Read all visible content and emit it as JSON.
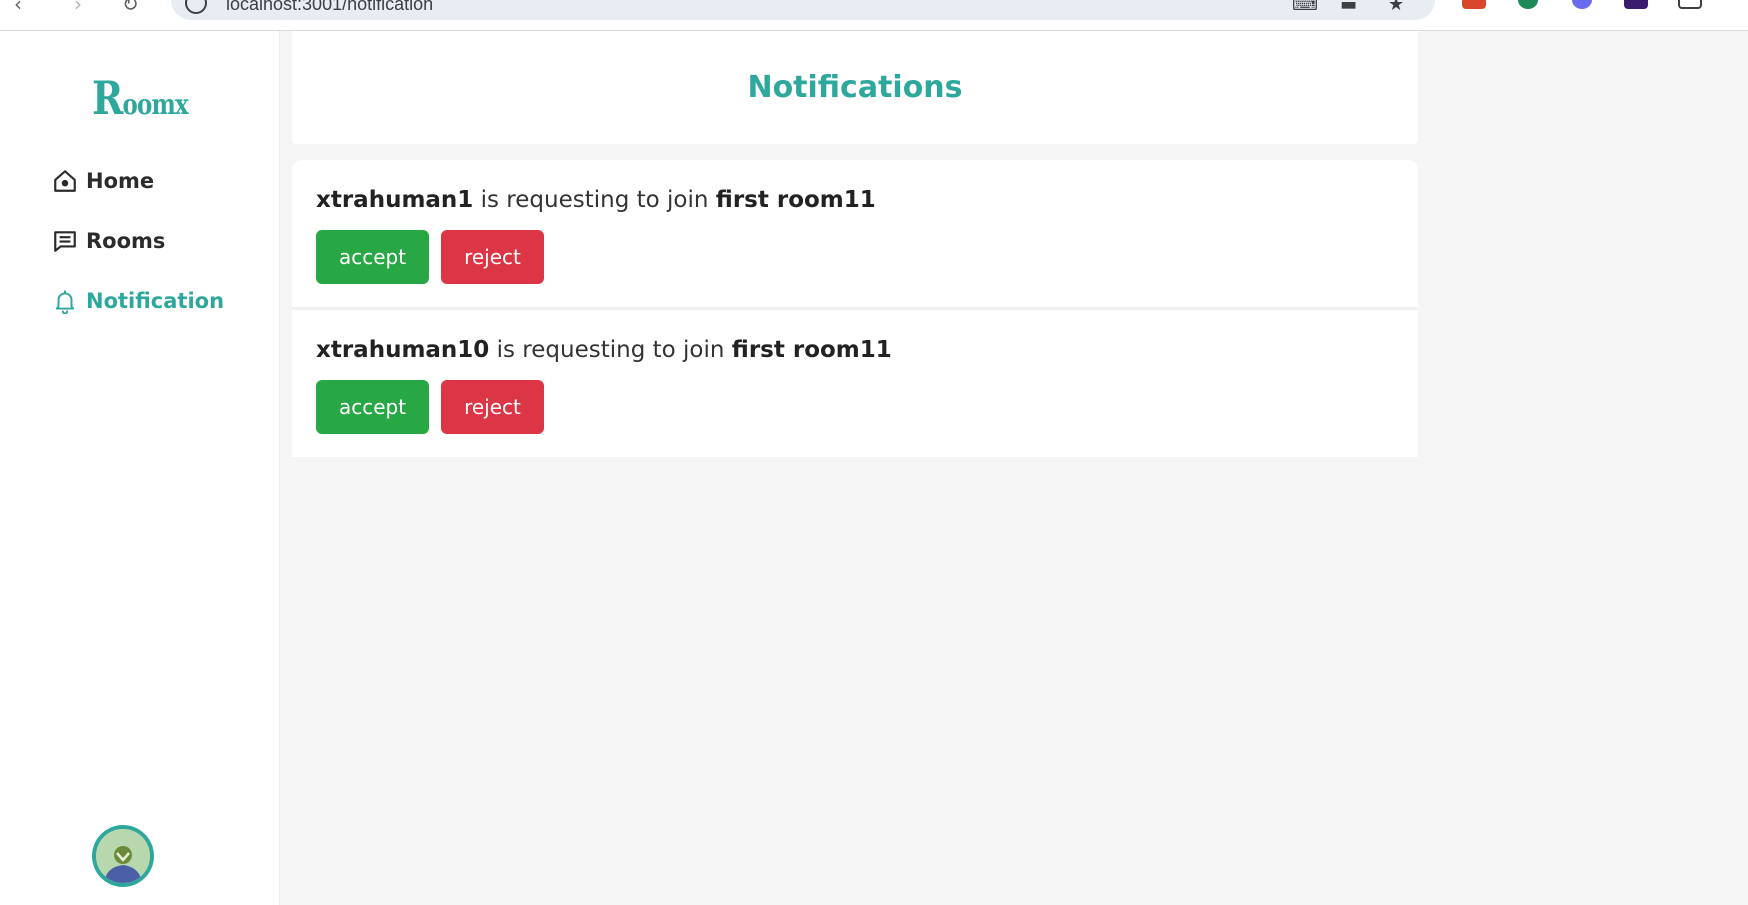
{
  "browser": {
    "url": "localhost:3001/notification",
    "colors": {
      "toolbar": "#ffffff",
      "omnibox": "#e8ecf3"
    }
  },
  "sidebar": {
    "logo_first": "R",
    "logo_rest": "oomx",
    "items": [
      {
        "label": "Home",
        "icon": "home-icon",
        "active": false
      },
      {
        "label": "Rooms",
        "icon": "chat-icon",
        "active": false
      },
      {
        "label": "Notification",
        "icon": "bell-icon",
        "active": true
      }
    ]
  },
  "main": {
    "title": "Notifications",
    "notifications": [
      {
        "user": "xtrahuman1",
        "message": " is requesting to join ",
        "room": "first room11",
        "accept_label": "accept",
        "reject_label": "reject"
      },
      {
        "user": "xtrahuman10",
        "message": " is requesting to join ",
        "room": "first room11",
        "accept_label": "accept",
        "reject_label": "reject"
      }
    ]
  },
  "colors": {
    "accent": "#2ea79c",
    "accept": "#28a745",
    "reject": "#dc3545",
    "background": "#f5f5f5"
  }
}
